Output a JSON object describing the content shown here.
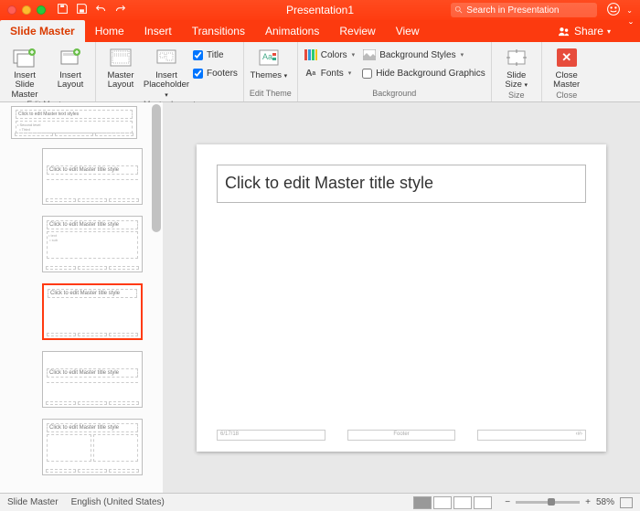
{
  "title": "Presentation1",
  "search_placeholder": "Search in Presentation",
  "tabs": {
    "slidemaster": "Slide Master",
    "home": "Home",
    "insert": "Insert",
    "transitions": "Transitions",
    "animations": "Animations",
    "review": "Review",
    "view": "View"
  },
  "share": "Share",
  "ribbon": {
    "insert_slide_master": "Insert Slide Master",
    "insert_layout": "Insert Layout",
    "edit_master_group": "Edit Master",
    "master_layout": "Master Layout",
    "insert_placeholder": "Insert Placeholder",
    "title_chk": "Title",
    "footers_chk": "Footers",
    "master_layout_group": "Master Layout",
    "themes": "Themes",
    "edit_theme_group": "Edit Theme",
    "colors": "Colors",
    "fonts": "Fonts",
    "bg_styles": "Background Styles",
    "hide_bg": "Hide Background Graphics",
    "background_group": "Background",
    "slide_size": "Slide Size",
    "size_group": "Size",
    "close_master": "Close Master",
    "close_group": "Close"
  },
  "thumbs": {
    "master_text": "Click to edit Master text styles",
    "layout_title": "Click to edit Master title style"
  },
  "slide": {
    "title_text": "Click to edit Master title style",
    "date": "6/17/18",
    "footer": "Footer",
    "num": "‹#›"
  },
  "status": {
    "mode": "Slide Master",
    "lang": "English (United States)",
    "zoom": "58%"
  }
}
